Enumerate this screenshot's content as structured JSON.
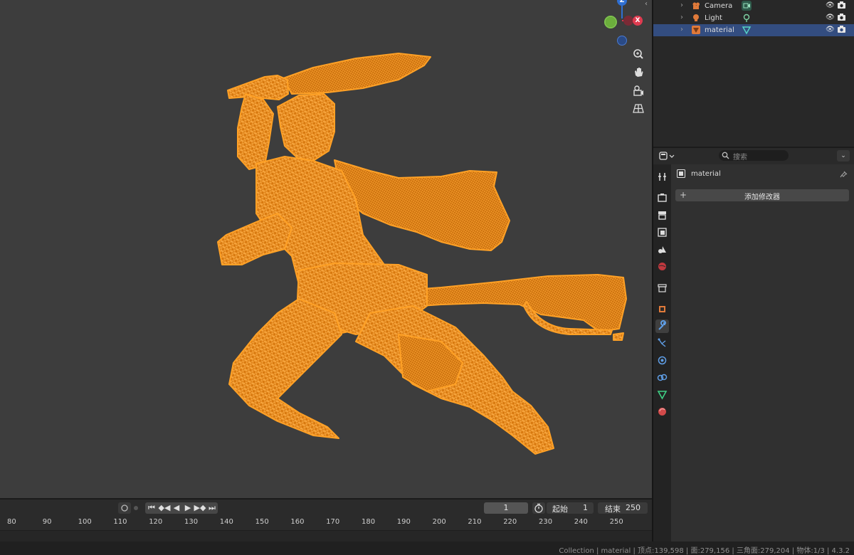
{
  "outliner": {
    "items": [
      {
        "label": "Camera",
        "icon": "camera-object-icon",
        "sub_icon": "camera-data-icon",
        "selected": false
      },
      {
        "label": "Light",
        "icon": "light-object-icon",
        "sub_icon": "light-data-icon",
        "selected": false
      },
      {
        "label": "material",
        "icon": "mesh-object-icon",
        "sub_icon": "mesh-data-icon",
        "selected": true
      }
    ]
  },
  "properties": {
    "search_placeholder": "搜索",
    "object_name": "material",
    "add_modifier_label": "添加修改器",
    "tabs": [
      "tool-icon",
      "render-icon",
      "output-icon",
      "view-layer-icon",
      "scene-icon",
      "world-icon",
      "collection-icon",
      "object-icon",
      "modifier-icon",
      "particles-icon",
      "physics-icon",
      "constraints-icon",
      "data-icon",
      "material-icon"
    ],
    "active_tab": "modifier-icon"
  },
  "viewport": {
    "gizmo": {
      "z": "Z",
      "x": "X"
    },
    "nav_buttons": [
      "zoom-icon",
      "pan-hand-icon",
      "camera-view-icon",
      "perspective-grid-icon"
    ],
    "mesh_color": "#ff9a1e"
  },
  "timeline": {
    "current_frame": "1",
    "start_label": "起始",
    "start_value": "1",
    "end_label": "结束",
    "end_value": "250",
    "ruler_ticks": [
      "80",
      "90",
      "100",
      "110",
      "120",
      "130",
      "140",
      "150",
      "160",
      "170",
      "180",
      "190",
      "200",
      "210",
      "220",
      "230",
      "240",
      "250"
    ]
  },
  "status_bar": {
    "text": "Collection | material | 顶点:139,598 | 面:279,156 | 三角面:279,204 | 物体:1/3 | 4.3.2"
  }
}
